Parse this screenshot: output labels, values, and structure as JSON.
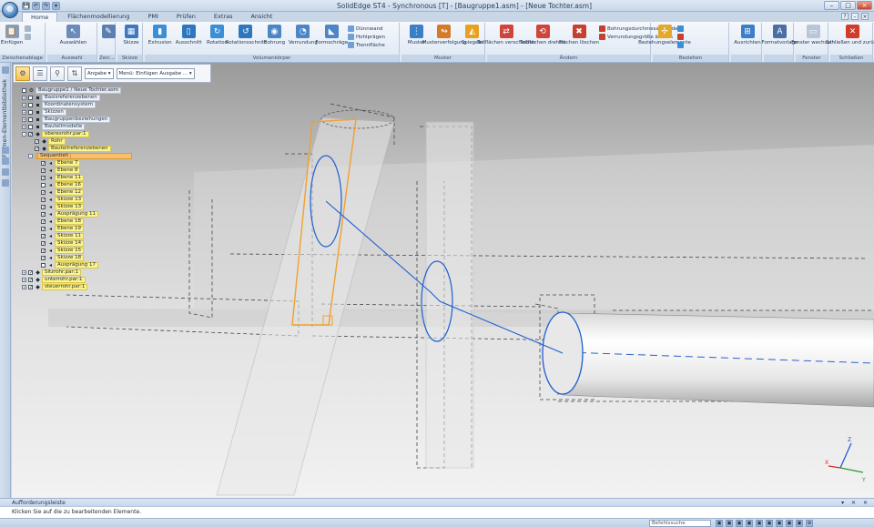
{
  "app": {
    "title": "SolidEdge ST4 - Synchronous [T] - [Baugruppe1.asm] - [Neue Tochter.asm]",
    "orb_glyph": "⚙",
    "qat": [
      "💾",
      "↶",
      "↷",
      "▾"
    ],
    "window_buttons": [
      "–",
      "□",
      "×"
    ]
  },
  "menu": {
    "tabs": [
      "Home",
      "Flächenmodellierung",
      "PMI",
      "Prüfen",
      "Extras",
      "Ansicht"
    ],
    "active_index": 0,
    "right_icons": [
      "?",
      "–",
      "×"
    ]
  },
  "ribbon": {
    "groups": [
      {
        "caption": "Zwischenablage",
        "buttons": [
          {
            "label": "Einfügen",
            "icon": "clipboard-icon",
            "color": "#8a9bb3",
            "glyph": "📋"
          }
        ],
        "small": [
          {
            "label": "",
            "color": "#a9b6c8"
          },
          {
            "label": "",
            "color": "#a9b6c8"
          }
        ]
      },
      {
        "caption": "Auswahl",
        "buttons": [
          {
            "label": "Auswählen",
            "icon": "select-arrow-icon",
            "color": "#6b8bb8",
            "glyph": "↖"
          }
        ]
      },
      {
        "caption": "Zeic...",
        "buttons": [
          {
            "label": "",
            "icon": "draw-icon",
            "color": "#5d7fb0",
            "glyph": "✎"
          }
        ]
      },
      {
        "caption": "Skizze",
        "buttons": [
          {
            "label": "Skizze",
            "icon": "sketch-icon",
            "color": "#3f78c2",
            "glyph": "▦"
          }
        ]
      },
      {
        "caption": "Volumenkörper",
        "buttons": [
          {
            "label": "Extrusion",
            "icon": "extrude-icon",
            "color": "#3a8fd6",
            "glyph": "▮"
          },
          {
            "label": "Ausschnitt",
            "icon": "cutout-icon",
            "color": "#2e77c0",
            "glyph": "▯"
          },
          {
            "label": "Rotation",
            "icon": "revolve-icon",
            "color": "#3a8fd6",
            "glyph": "↻"
          },
          {
            "label": "Rotationsschnitt",
            "icon": "revolve-cut-icon",
            "color": "#2e77c0",
            "glyph": "↺"
          },
          {
            "label": "Bohrung",
            "icon": "hole-icon",
            "color": "#4d86c4",
            "glyph": "◉"
          },
          {
            "label": "Verrundung",
            "icon": "round-icon",
            "color": "#4d86c4",
            "glyph": "◔"
          },
          {
            "label": "Formschräge",
            "icon": "draft-icon",
            "color": "#4d86c4",
            "glyph": "◣"
          }
        ],
        "small": [
          {
            "label": "Dünnwand",
            "color": "#6fa1d8"
          },
          {
            "label": "Hohlprägen",
            "color": "#6fa1d8"
          },
          {
            "label": "Trennfläche",
            "color": "#6fa1d8"
          }
        ]
      },
      {
        "caption": "Muster",
        "buttons": [
          {
            "label": "Muster",
            "icon": "pattern-icon",
            "color": "#3b7fc6",
            "glyph": "⋮"
          },
          {
            "label": "Musterverfolgung",
            "icon": "pattern-along-curve-icon",
            "color": "#d47a2b",
            "glyph": "↬"
          },
          {
            "label": "Spiegeln",
            "icon": "mirror-icon",
            "color": "#e8a020",
            "glyph": "◭"
          }
        ]
      },
      {
        "caption": "Ändern",
        "buttons": [
          {
            "label": "Teilflächen verschieben",
            "icon": "move-faces-icon",
            "color": "#d0453a",
            "glyph": "⇄"
          },
          {
            "label": "Teilflächen drehen",
            "icon": "rotate-faces-icon",
            "color": "#d0453a",
            "glyph": "⟲"
          },
          {
            "label": "Flächen löschen",
            "icon": "delete-faces-icon",
            "color": "#c5402f",
            "glyph": "✖"
          }
        ],
        "small": [
          {
            "label": "Bohrungsdurchmesser ändern",
            "color": "#c5402f"
          },
          {
            "label": "Verrundungsgröße ändern",
            "color": "#c5402f"
          }
        ]
      },
      {
        "caption": "Beziehen",
        "buttons": [
          {
            "label": "Beziehungselemente",
            "icon": "relate-icon",
            "color": "#e3a92b",
            "glyph": "✢"
          }
        ],
        "small": [
          {
            "label": "",
            "color": "#3a8fd6"
          },
          {
            "label": "",
            "color": "#c5402f"
          },
          {
            "label": "",
            "color": "#3a8fd6"
          }
        ]
      },
      {
        "caption": "",
        "buttons": [
          {
            "label": "Ausrichten",
            "icon": "align-icon",
            "color": "#3b7fc6",
            "glyph": "⊞"
          }
        ]
      },
      {
        "caption": "",
        "buttons": [
          {
            "label": "Formatvorlage",
            "icon": "style-icon",
            "color": "#4a6fa5",
            "glyph": "A"
          }
        ]
      },
      {
        "caption": "Fenster",
        "buttons": [
          {
            "label": "Fenster wechseln",
            "icon": "switch-window-icon",
            "color": "#b9c6d8",
            "glyph": "▭"
          }
        ]
      },
      {
        "caption": "Schließen",
        "buttons": [
          {
            "label": "Schließen und zurück",
            "icon": "close-return-icon",
            "color": "#d23a2a",
            "glyph": "✕"
          }
        ]
      }
    ]
  },
  "leftbar": {
    "label": "Formen-Elementbibliothek"
  },
  "tree_toolbar": {
    "buttons": [
      {
        "icon": "pathfinder-icon",
        "glyph": "⚙",
        "on": true
      },
      {
        "icon": "tree-list-icon",
        "glyph": "☰",
        "on": false
      },
      {
        "icon": "filter-icon",
        "glyph": "⚲",
        "on": false
      },
      {
        "icon": "sort-icon",
        "glyph": "⇅",
        "on": false
      }
    ],
    "select_value": "Angabe ▾",
    "select2_value": "Menü: Einfügen Ausgabe ... ▾"
  },
  "tree": {
    "rows": [
      {
        "indent": 0,
        "exp": "",
        "chk": "",
        "icon": "⚙",
        "label": "Baugruppe1 / Neue Tochter.asm",
        "style": "gray"
      },
      {
        "indent": 1,
        "exp": "+",
        "chk": "",
        "icon": "▪",
        "label": "Basisreferenzebenen",
        "style": ""
      },
      {
        "indent": 1,
        "exp": "+",
        "chk": "",
        "icon": "▪",
        "label": "Koordinatensystem",
        "style": ""
      },
      {
        "indent": 1,
        "exp": "+",
        "chk": "",
        "icon": "▪",
        "label": "Skizzen",
        "style": ""
      },
      {
        "indent": 1,
        "exp": "+",
        "chk": "",
        "icon": "▪",
        "label": "Baugruppenbeziehungen",
        "style": ""
      },
      {
        "indent": 1,
        "exp": "+",
        "chk": "",
        "icon": "▪",
        "label": "Bauteilmodelle",
        "style": ""
      },
      {
        "indent": 1,
        "exp": "-",
        "chk": "✓",
        "icon": "◆",
        "label": "oberesrohr.par:1",
        "style": "yellow"
      },
      {
        "indent": 2,
        "exp": "",
        "chk": "✓",
        "icon": "◆",
        "label": "Rohr",
        "style": "yellow"
      },
      {
        "indent": 2,
        "exp": "",
        "chk": "✓",
        "icon": "◆",
        "label": "Bauteilreferenzebenen",
        "style": "yellow"
      },
      {
        "indent": 2,
        "exp": "-",
        "chk": "",
        "icon": "",
        "label": "Sequentiell",
        "style": "orange-bar"
      },
      {
        "indent": 3,
        "exp": "",
        "chk": "✓",
        "icon": "◂",
        "label": "Ebene 7",
        "style": "yellow"
      },
      {
        "indent": 3,
        "exp": "",
        "chk": "✓",
        "icon": "◂",
        "label": "Ebene 8",
        "style": "yellow"
      },
      {
        "indent": 3,
        "exp": "",
        "chk": "✓",
        "icon": "◂",
        "label": "Ebene 11",
        "style": "yellow"
      },
      {
        "indent": 3,
        "exp": "",
        "chk": "",
        "icon": "◂",
        "label": "Ebene 16",
        "style": "yellow"
      },
      {
        "indent": 3,
        "exp": "",
        "chk": "✓",
        "icon": "◂",
        "label": "Ebene 12",
        "style": "yellow"
      },
      {
        "indent": 3,
        "exp": "",
        "chk": "✓",
        "icon": "◂",
        "label": "Skizze 13",
        "style": "yellow"
      },
      {
        "indent": 3,
        "exp": "",
        "chk": "✓",
        "icon": "◂",
        "label": "Skizze 13",
        "style": "yellow"
      },
      {
        "indent": 3,
        "exp": "",
        "chk": "✓",
        "icon": "◂",
        "label": "Ausprägung 11",
        "style": "yellow"
      },
      {
        "indent": 3,
        "exp": "",
        "chk": "✓",
        "icon": "◂",
        "label": "Ebene 18",
        "style": "yellow"
      },
      {
        "indent": 3,
        "exp": "",
        "chk": "✓",
        "icon": "◂",
        "label": "Ebene 19",
        "style": "yellow"
      },
      {
        "indent": 3,
        "exp": "",
        "chk": "✓",
        "icon": "◂",
        "label": "Skizze 11",
        "style": "yellow"
      },
      {
        "indent": 3,
        "exp": "",
        "chk": "✓",
        "icon": "◂",
        "label": "Skizze 14",
        "style": "yellow"
      },
      {
        "indent": 3,
        "exp": "",
        "chk": "✓",
        "icon": "◂",
        "label": "Skizze 15",
        "style": "yellow"
      },
      {
        "indent": 3,
        "exp": "",
        "chk": "✓",
        "icon": "◂",
        "label": "Skizze 18",
        "style": "yellow"
      },
      {
        "indent": 3,
        "exp": "",
        "chk": "",
        "icon": "◂",
        "label": "Ausprägung 17",
        "style": "yellow"
      },
      {
        "indent": 1,
        "exp": "+",
        "chk": "✓",
        "icon": "◆",
        "label": "Sitzrohr.par:1",
        "style": "yellow"
      },
      {
        "indent": 1,
        "exp": "+",
        "chk": "✓",
        "icon": "◆",
        "label": "unterrohr.par:1",
        "style": "yellow"
      },
      {
        "indent": 1,
        "exp": "+",
        "chk": "✓",
        "icon": "◆",
        "label": "steuerrohr.par:1",
        "style": "yellow"
      }
    ]
  },
  "bottom": {
    "header": "Aufforderungsleiste",
    "header_controls": "▾ ✕ ✕",
    "message": "Klicken Sie auf die zu bearbeitenden Elemente."
  },
  "status": {
    "search_placeholder": "Befehlssuche",
    "icons": [
      "▣",
      "▣",
      "▣",
      "▣",
      "▣",
      "▣",
      "▣",
      "▣",
      "▣",
      "⊕"
    ]
  },
  "triad": {
    "x": "X",
    "y": "Y",
    "z": "Z"
  }
}
